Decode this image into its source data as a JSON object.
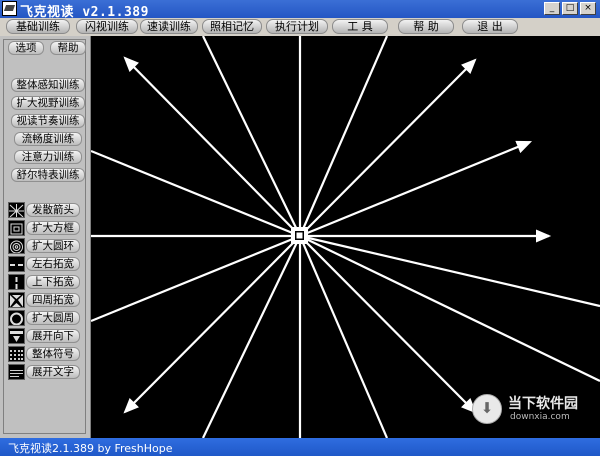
{
  "window": {
    "title": "飞克视读 v2.1.389",
    "min": "_",
    "max": "□",
    "close": "×"
  },
  "menu": [
    "基础训练",
    "闪视训练",
    "速读训练",
    "照相记忆",
    "执行计划",
    "工 具",
    "帮 助",
    "退 出"
  ],
  "sidebar": {
    "top": [
      "选项",
      "帮助"
    ],
    "training": [
      "整体感知训练",
      "扩大视野训练",
      "视读节奏训练",
      "流畅度训练",
      "注意力训练",
      "舒尔特表训练"
    ],
    "modes": [
      {
        "icon": "burst-icon",
        "label": "发散箭头"
      },
      {
        "icon": "expand-square-icon",
        "label": "扩大方框"
      },
      {
        "icon": "concentric-rings-icon",
        "label": "扩大圆环"
      },
      {
        "icon": "horizontal-expand-icon",
        "label": "左右拓宽"
      },
      {
        "icon": "vertical-expand-icon",
        "label": "上下拓宽"
      },
      {
        "icon": "four-way-expand-icon",
        "label": "四周拓宽"
      },
      {
        "icon": "circle-expand-icon",
        "label": "扩大圆周"
      },
      {
        "icon": "unfold-down-icon",
        "label": "展开向下"
      },
      {
        "icon": "symbol-grid-icon",
        "label": "整体符号"
      },
      {
        "icon": "text-unfold-icon",
        "label": "展开文字"
      }
    ]
  },
  "status": "飞克视读2.1.389 by FreshHope",
  "watermark": {
    "name": "当下软件园",
    "url": "downxia.com"
  },
  "colors": {
    "title_bar": "#2456c4",
    "panel": "#c0c0c0",
    "canvas": "#000000",
    "arrows": "#ffffff"
  }
}
